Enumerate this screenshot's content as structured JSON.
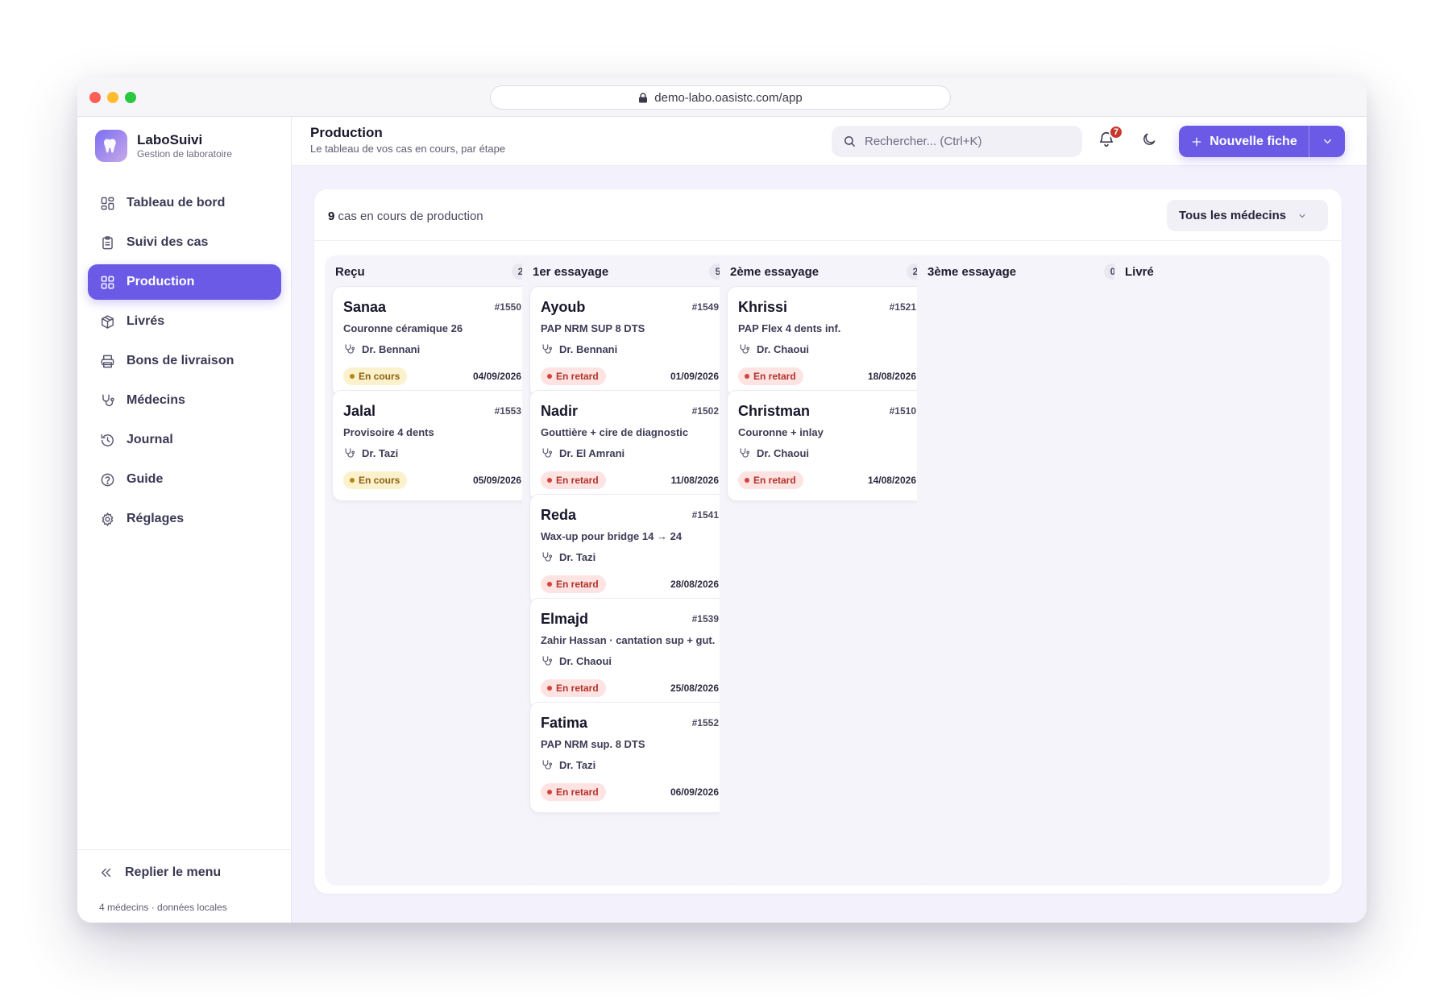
{
  "browser": {
    "url": "demo-labo.oasistc.com/app"
  },
  "brand": {
    "name": "LaboSuivi",
    "subtitle": "Gestion de laboratoire"
  },
  "sidebar": {
    "items": [
      {
        "label": "Tableau de bord",
        "icon": "dashboard-icon"
      },
      {
        "label": "Suivi des cas",
        "icon": "clipboard-icon"
      },
      {
        "label": "Production",
        "icon": "grid-icon",
        "active": true
      },
      {
        "label": "Livrés",
        "icon": "package-icon"
      },
      {
        "label": "Bons de livraison",
        "icon": "printer-icon"
      },
      {
        "label": "Médecins",
        "icon": "stethoscope-icon"
      },
      {
        "label": "Journal",
        "icon": "history-icon"
      },
      {
        "label": "Guide",
        "icon": "help-icon"
      },
      {
        "label": "Réglages",
        "icon": "gear-icon"
      }
    ],
    "collapse_label": "Replier le menu",
    "footer_note": "4 médecins · données locales"
  },
  "header": {
    "title": "Production",
    "subtitle": "Le tableau de vos cas en cours, par étape",
    "search_placeholder": "Rechercher...  (Ctrl+K)",
    "notifications_count": "7",
    "new_button_label": "Nouvelle fiche"
  },
  "board": {
    "count": "9",
    "count_label": "cas en cours de production",
    "filter_label": "Tous les médecins",
    "columns": [
      {
        "title": "Reçu",
        "count": "2",
        "cards": [
          {
            "name": "Sanaa",
            "id": "#1550",
            "desc": "Couronne céramique 26",
            "doctor": "Dr. Bennani",
            "status": "En cours",
            "status_type": "ok",
            "date": "04/09/2026"
          },
          {
            "name": "Jalal",
            "id": "#1553",
            "desc": "Provisoire 4 dents",
            "doctor": "Dr. Tazi",
            "status": "En cours",
            "status_type": "ok",
            "date": "05/09/2026"
          }
        ]
      },
      {
        "title": "1er essayage",
        "count": "5",
        "cards": [
          {
            "name": "Ayoub",
            "id": "#1549",
            "desc": "PAP NRM SUP 8 DTS",
            "doctor": "Dr. Bennani",
            "status": "En retard",
            "status_type": "late",
            "date": "01/09/2026"
          },
          {
            "name": "Nadir",
            "id": "#1502",
            "desc": "Gouttière + cire de diagnostic",
            "doctor": "Dr. El Amrani",
            "status": "En retard",
            "status_type": "late",
            "date": "11/08/2026"
          },
          {
            "name": "Reda",
            "id": "#1541",
            "desc": "Wax-up pour bridge 14 → 24",
            "doctor": "Dr. Tazi",
            "status": "En retard",
            "status_type": "late",
            "date": "28/08/2026"
          },
          {
            "name": "Elmajd",
            "id": "#1539",
            "desc": "Zahir Hassan · cantation sup + gut.",
            "doctor": "Dr. Chaoui",
            "status": "En retard",
            "status_type": "late",
            "date": "25/08/2026"
          },
          {
            "name": "Fatima",
            "id": "#1552",
            "desc": "PAP NRM sup. 8 DTS",
            "doctor": "Dr. Tazi",
            "status": "En retard",
            "status_type": "late",
            "date": "06/09/2026"
          }
        ]
      },
      {
        "title": "2ème essayage",
        "count": "2",
        "cards": [
          {
            "name": "Khrissi",
            "id": "#1521",
            "desc": "PAP Flex 4 dents inf.",
            "doctor": "Dr. Chaoui",
            "status": "En retard",
            "status_type": "late",
            "date": "18/08/2026"
          },
          {
            "name": "Christman",
            "id": "#1510",
            "desc": "Couronne + inlay",
            "doctor": "Dr. Chaoui",
            "status": "En retard",
            "status_type": "late",
            "date": "14/08/2026"
          }
        ]
      },
      {
        "title": "3ème essayage",
        "count": "0",
        "cards": []
      },
      {
        "title": "Livré",
        "count": "",
        "cards": []
      }
    ]
  },
  "colors": {
    "accent": "#6a5ae6",
    "late": "#b3322a",
    "in_progress": "#8a6110"
  }
}
